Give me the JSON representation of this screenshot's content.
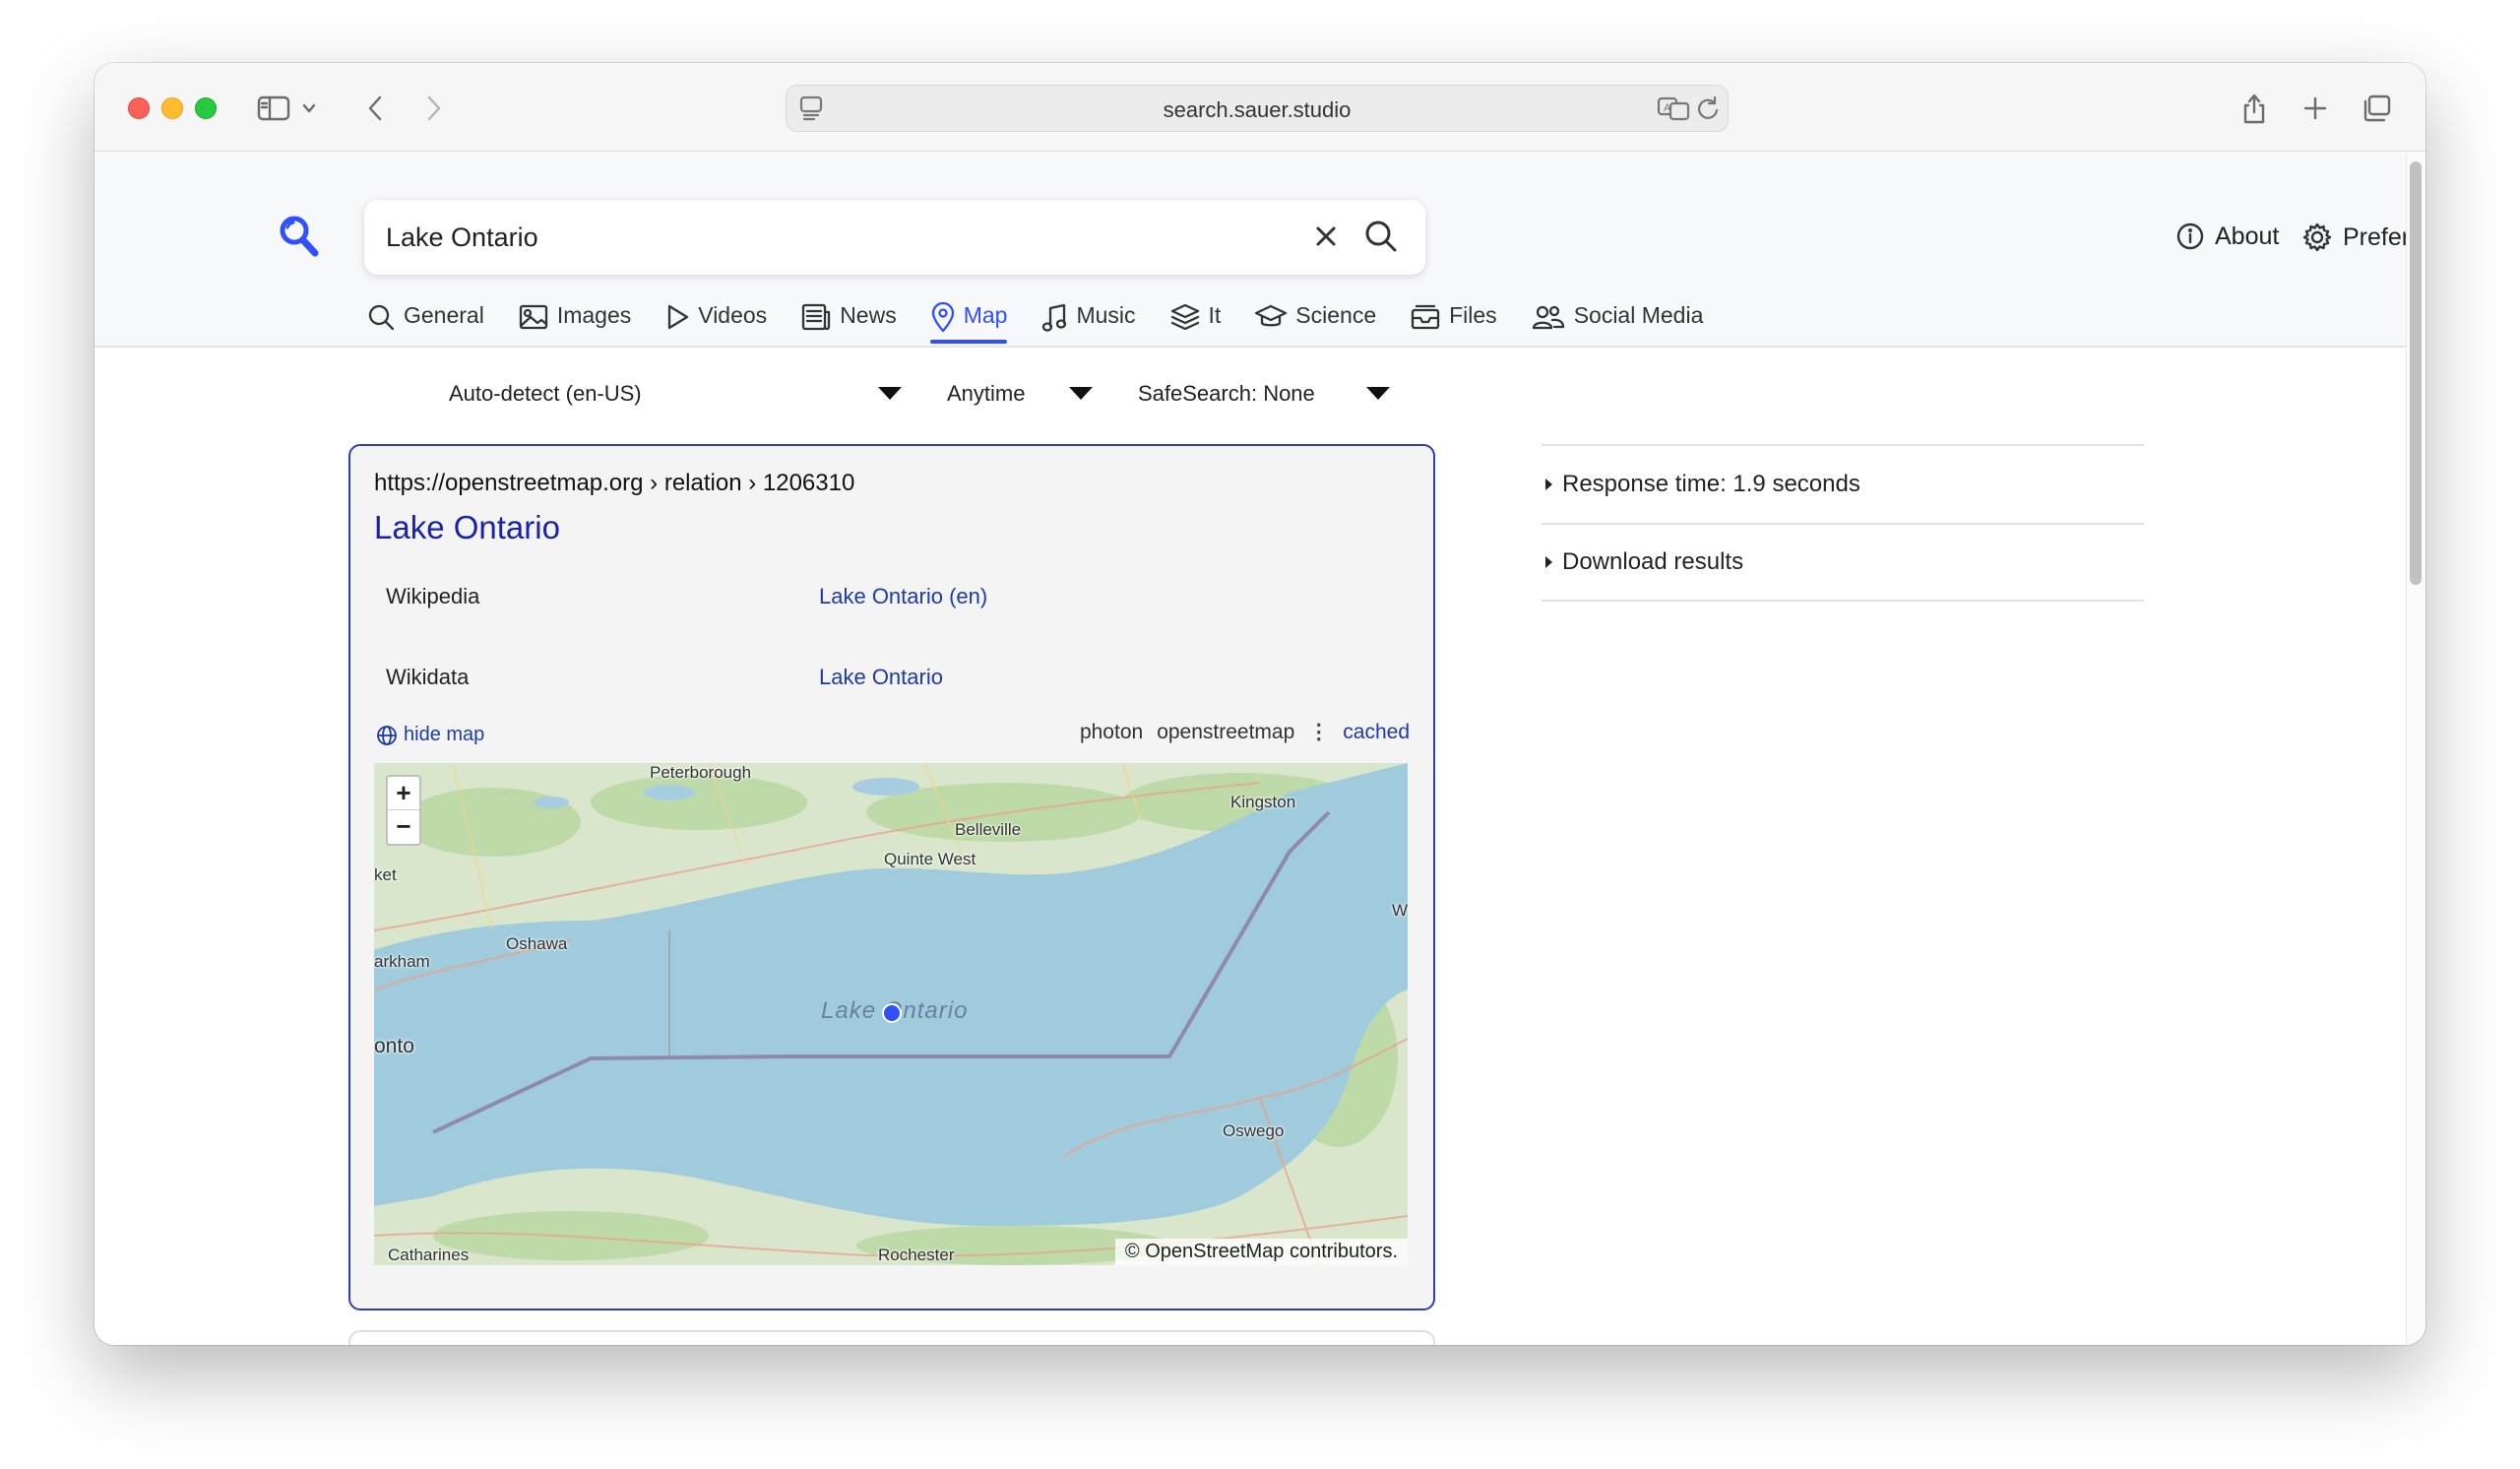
{
  "browser": {
    "url": "search.sauer.studio"
  },
  "search": {
    "query": "Lake Ontario"
  },
  "header": {
    "about_label": "About",
    "preferences_label": "Preferences"
  },
  "tabs": [
    {
      "label": "General",
      "icon": "search-icon"
    },
    {
      "label": "Images",
      "icon": "image-icon"
    },
    {
      "label": "Videos",
      "icon": "play-icon"
    },
    {
      "label": "News",
      "icon": "newspaper-icon"
    },
    {
      "label": "Map",
      "icon": "map-pin-icon",
      "active": true
    },
    {
      "label": "Music",
      "icon": "music-note-icon"
    },
    {
      "label": "It",
      "icon": "layers-icon"
    },
    {
      "label": "Science",
      "icon": "graduation-cap-icon"
    },
    {
      "label": "Files",
      "icon": "file-tray-icon"
    },
    {
      "label": "Social Media",
      "icon": "people-icon"
    }
  ],
  "filters": {
    "language": "Auto-detect (en-US)",
    "time": "Anytime",
    "safesearch": "SafeSearch: None"
  },
  "result": {
    "url": "https://openstreetmap.org",
    "breadcrumb": "› relation › 1206310",
    "title": "Lake Ontario",
    "attributes": [
      {
        "label": "Wikipedia",
        "value": "Lake Ontario (en)"
      },
      {
        "label": "Wikidata",
        "value": "Lake Ontario"
      }
    ],
    "hide_map_label": "hide map",
    "engines": [
      "photon",
      "openstreetmap"
    ],
    "cached_label": "cached",
    "map": {
      "zoom_in": "+",
      "zoom_out": "−",
      "attribution": "© OpenStreetMap contributors.",
      "lake_label": "Lake Ontario",
      "places": [
        "Peterborough",
        "Belleville",
        "Kingston",
        "Quinte West",
        "Oshawa",
        "Oswego",
        "Rochester",
        "Catharines",
        "onto",
        "arkham",
        "ket",
        "W"
      ]
    }
  },
  "sidebar": {
    "response_time": "Response time: 1.9 seconds",
    "download": "Download results"
  },
  "colors": {
    "accent": "#3050ff",
    "link": "#1a23a8",
    "lake": "#9fcbdc"
  }
}
